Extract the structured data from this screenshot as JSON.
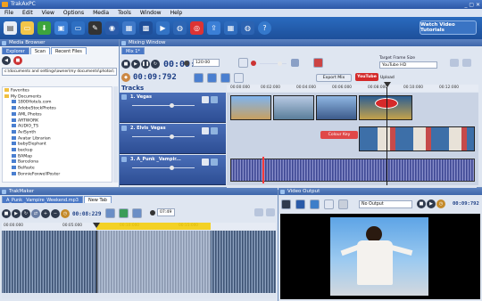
{
  "app": {
    "title": "TrakAxPC"
  },
  "menu": [
    "File",
    "Edit",
    "View",
    "Options",
    "Media",
    "Tools",
    "Window",
    "Help"
  ],
  "toolbar": {
    "tutorial_label": "Watch Video Tutorials"
  },
  "media_browser": {
    "title": "Media Browser",
    "tabs": [
      "Explorer",
      "Scan",
      "Recent Files"
    ],
    "path": "c:\\documents and settings\\owner\\my documents\\photos\\",
    "tree": [
      "Favorites",
      "My Documents",
      "1800Hotels.com",
      "AdobeStockPhotos",
      "AML Photos",
      "ARTWORK",
      "AUDIO_TS",
      "AviSynth",
      "Avatar Librarian",
      "babyElephant",
      "backup",
      "BAMap",
      "Barcelona",
      "Belfaste",
      "BonnieFoxwellPoster"
    ]
  },
  "mixing_window": {
    "title": "Mixing Window",
    "tab": "Mix 1*",
    "timecode": "00:09:792",
    "zoom": "120:00",
    "target_label": "Target Frame Size",
    "target_value": "YouTube HD",
    "export_label": "Export Mix",
    "upload_label": "Upload",
    "youtube_label": "YouTube",
    "tracks_label": "Tracks",
    "ruler": [
      "00:00:000",
      "00:02:000",
      "00:04:000",
      "00:06:000",
      "00:08:000",
      "00:10:000",
      "00:12:000",
      "00:14:000"
    ],
    "tracks": [
      {
        "name": "1. Vegas"
      },
      {
        "name": "2. Elvis_Vegas"
      },
      {
        "name": "3. A_Punk _Vampir..."
      }
    ],
    "colour_key_label": "Colour Key"
  },
  "trakmaker": {
    "title": "TrakMaker",
    "file_tab": "A_Punk _Vampire_Weekend.mp3",
    "new_tab": "New Tab",
    "timecode": "00:08:229",
    "volume": "07:49",
    "ruler": [
      "00:00:000",
      "00:05:000",
      "00:10:000",
      "00:15:000"
    ]
  },
  "video_output": {
    "title": "Video Output",
    "output_value": "No Output",
    "timecode": "00:09:792"
  },
  "colors": {
    "accent": "#2b57a6",
    "timeline": "#f5cc00",
    "clip_red": "#c43030"
  }
}
